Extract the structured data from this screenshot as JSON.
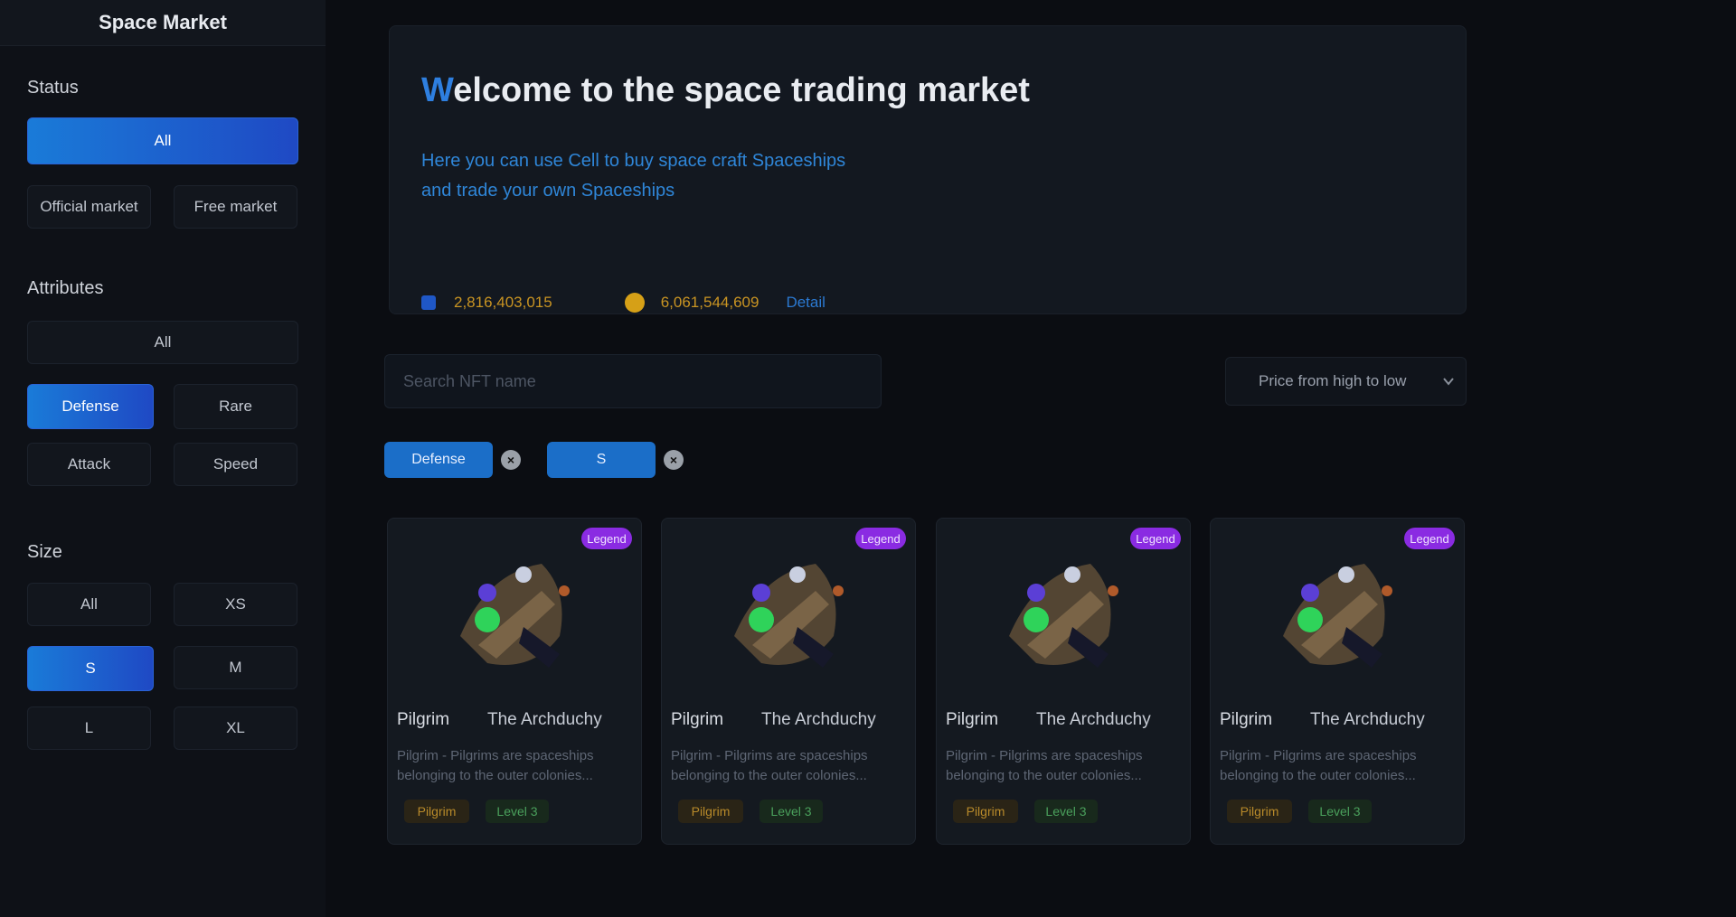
{
  "sidebar": {
    "title": "Space Market",
    "status": {
      "label": "Status",
      "all": "All",
      "options": [
        "Official market",
        "Free market"
      ]
    },
    "attributes": {
      "label": "Attributes",
      "all": "All",
      "options": [
        "Defense",
        "Rare",
        "Attack",
        "Speed"
      ],
      "active": "Defense"
    },
    "size": {
      "label": "Size",
      "options": [
        "All",
        "XS",
        "S",
        "M",
        "L",
        "XL"
      ],
      "active": "S"
    }
  },
  "hero": {
    "title_first": "W",
    "title_rest": "elcome to the space trading market",
    "desc_line1": "Here you can use Cell to buy space craft Spaceships",
    "desc_line2": "and trade your own Spaceships",
    "stat1": "2,816,403,015",
    "stat2": "6,061,544,609",
    "link": "Detail"
  },
  "search": {
    "placeholder": "Search NFT name"
  },
  "sort": {
    "label": "Price from high to low",
    "icon": "chevron-down-icon"
  },
  "filters": {
    "chips": [
      "Defense",
      "S"
    ]
  },
  "cards": [
    {
      "badge": "Legend",
      "name": "Pilgrim",
      "subtitle": "The Archduchy",
      "desc": "Pilgrim - Pilgrims are spaceships belonging to the outer colonies...",
      "tag1": "Pilgrim",
      "tag2": "Level 3"
    },
    {
      "badge": "Legend",
      "name": "Pilgrim",
      "subtitle": "The Archduchy",
      "desc": "Pilgrim - Pilgrims are spaceships belonging to the outer colonies...",
      "tag1": "Pilgrim",
      "tag2": "Level 3"
    },
    {
      "badge": "Legend",
      "name": "Pilgrim",
      "subtitle": "The Archduchy",
      "desc": "Pilgrim - Pilgrims are spaceships belonging to the outer colonies...",
      "tag1": "Pilgrim",
      "tag2": "Level 3"
    },
    {
      "badge": "Legend",
      "name": "Pilgrim",
      "subtitle": "The Archduchy",
      "desc": "Pilgrim - Pilgrims are spaceships belonging to the outer colonies...",
      "tag1": "Pilgrim",
      "tag2": "Level 3"
    }
  ],
  "colors": {
    "accent": "#1a7bd8",
    "badge": "#8a2be2",
    "gold": "#c99422",
    "green": "#4aa05c"
  }
}
